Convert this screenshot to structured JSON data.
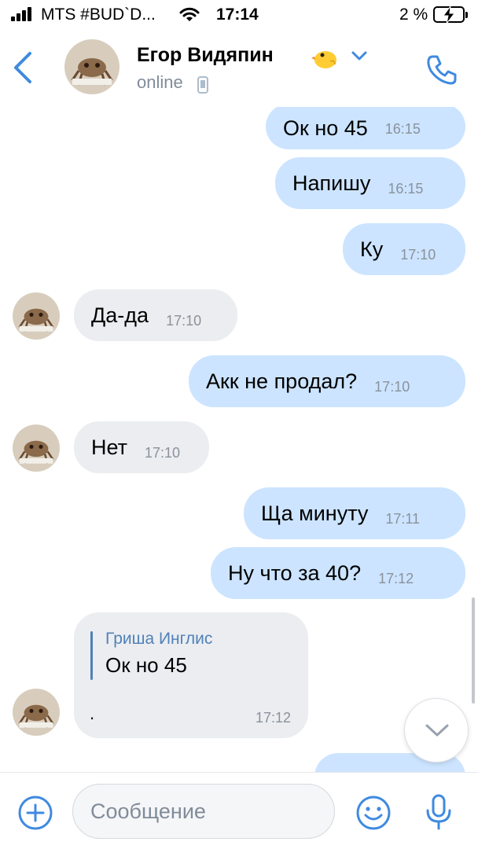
{
  "status_bar": {
    "carrier": "MTS #BUD`D...",
    "time": "17:14",
    "battery": "2 %",
    "icons": [
      "signal-icon",
      "wifi-icon",
      "battery-charging-icon"
    ]
  },
  "header": {
    "contact_name": "Егор Видяпин",
    "status": "online",
    "icons": [
      "back-icon",
      "chick-emoji-icon",
      "chevron-down-icon",
      "mobile-indicator-icon",
      "phone-call-icon"
    ]
  },
  "messages": [
    {
      "dir": "out",
      "text": "Ок но 45",
      "time": "16:15"
    },
    {
      "dir": "out",
      "text": "Напишу",
      "time": "16:15"
    },
    {
      "dir": "out",
      "text": "Ку",
      "time": "17:10"
    },
    {
      "dir": "in",
      "text": "Да-да",
      "time": "17:10"
    },
    {
      "dir": "out",
      "text": "Акк не продал?",
      "time": "17:10"
    },
    {
      "dir": "in",
      "text": "Нет",
      "time": "17:10"
    },
    {
      "dir": "out",
      "text": "Ща минуту",
      "time": "17:11"
    },
    {
      "dir": "out",
      "text": "Ну что за 40?",
      "time": "17:12"
    }
  ],
  "reply_message": {
    "author": "Гриша Инглис",
    "quote": "Ок но 45",
    "text": ".",
    "time": "17:12"
  },
  "input": {
    "placeholder": "Сообщение",
    "value": "",
    "icons": [
      "add-attachment-icon",
      "emoji-icon",
      "microphone-icon"
    ]
  },
  "colors": {
    "accent": "#5181b8",
    "outgoing_bubble": "#cce4ff",
    "incoming_bubble": "#ebedf0",
    "secondary_text": "#818c99"
  }
}
